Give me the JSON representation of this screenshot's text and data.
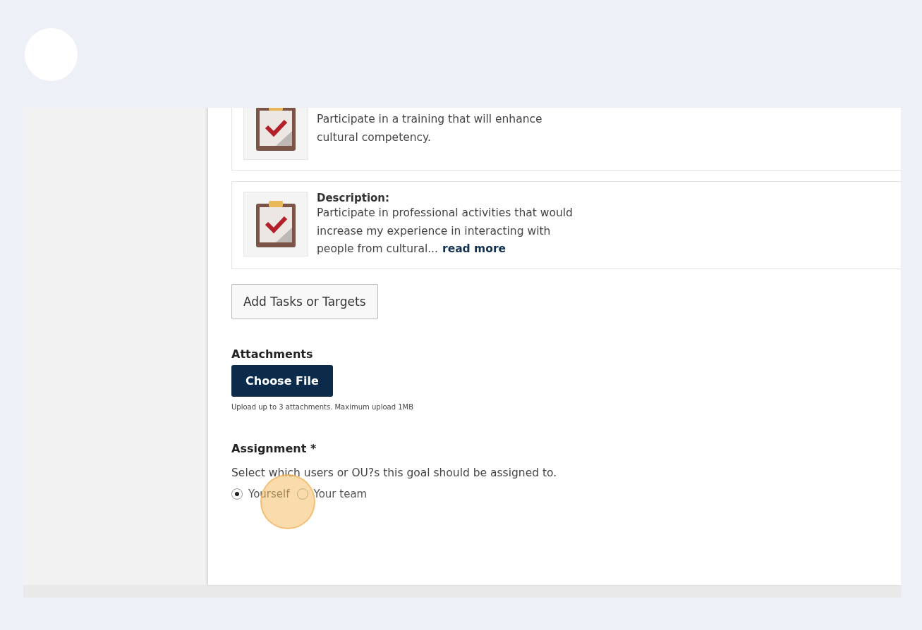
{
  "tasks": [
    {
      "description": "Participate in a training that will enhance cultural competency."
    },
    {
      "heading": "Description:",
      "description": "Participate in professional activities that would increase my experience in interacting with people from cultural...",
      "more_link": "read more"
    }
  ],
  "add_button": "Add Tasks or Targets",
  "attachments": {
    "label": "Attachments",
    "button": "Choose File",
    "hint": "Upload up to 3 attachments. Maximum upload 1MB"
  },
  "assignment": {
    "label": "Assignment *",
    "help": "Select which users or OU?s this goal should be assigned to.",
    "options": [
      {
        "label": "Yourself",
        "selected": true
      },
      {
        "label": "Your team",
        "selected": false
      }
    ]
  }
}
